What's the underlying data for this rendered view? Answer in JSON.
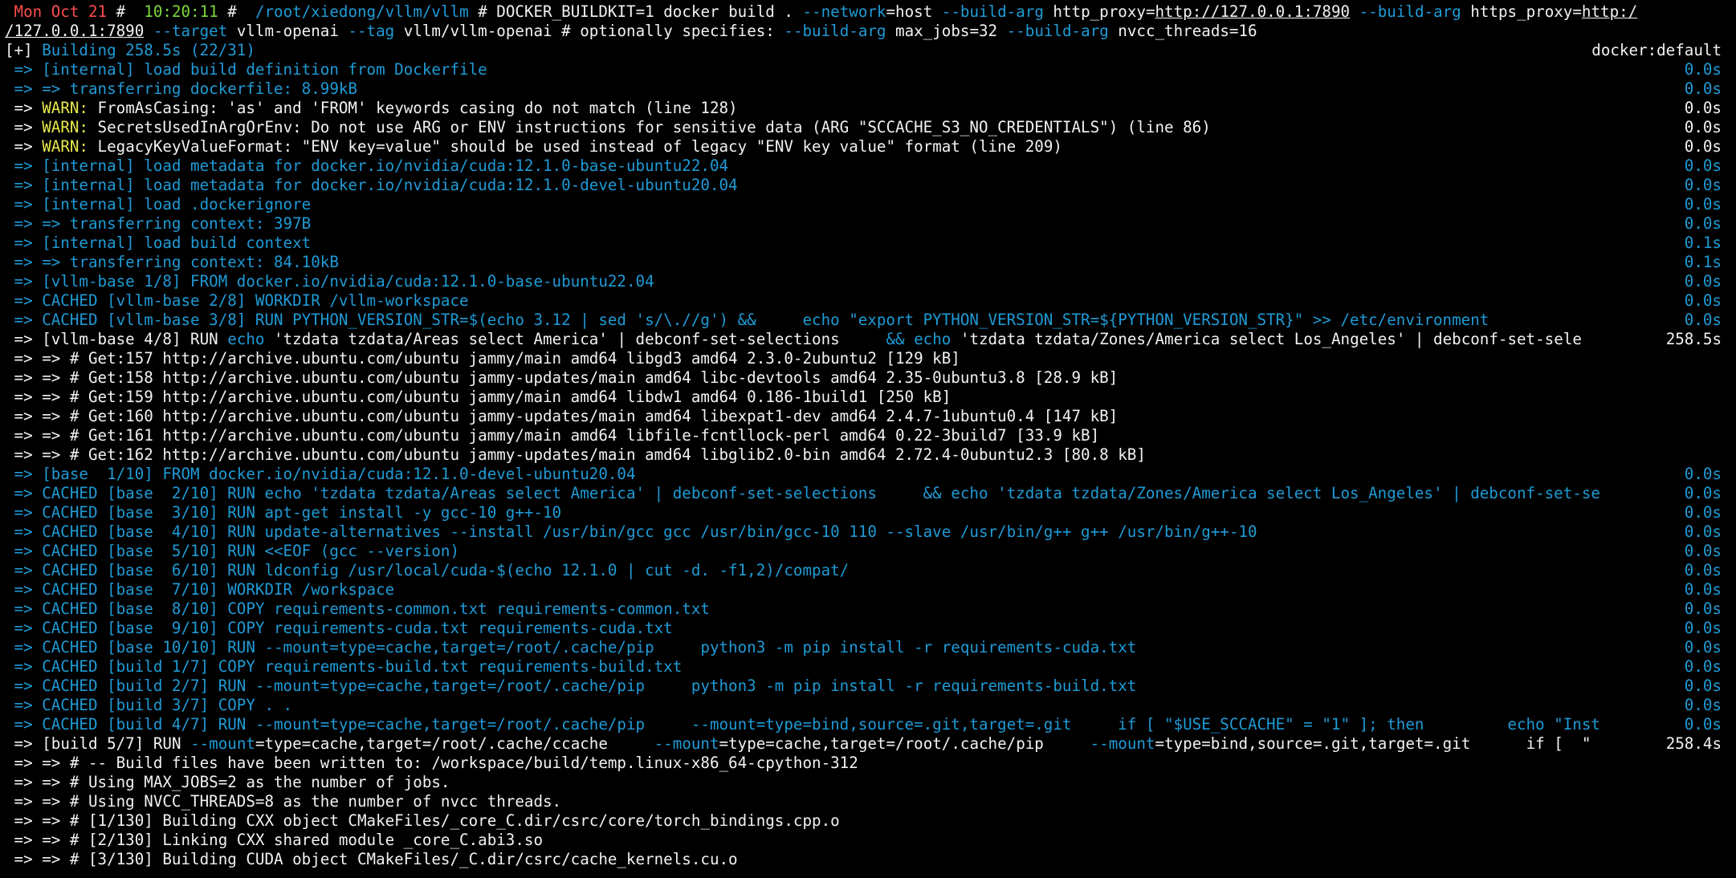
{
  "colors": {
    "background": "#000000",
    "blue": "#1f9bd6",
    "yellow": "#e8e84a",
    "red": "#ff4d4d",
    "green": "#7bd93b",
    "white": "#f2f2f2"
  },
  "prompt": {
    "date": " Mon Oct 21 ",
    "sep1": "#",
    "time": "  10:20:11 ",
    "sep2": "#",
    "cwd": "  /root/xiedong/vllm/vllm ",
    "hash": "# ",
    "cmd_part1": "DOCKER_BUILDKIT=1 docker build . ",
    "flag_network": "--network",
    "cmd_part2": "=host ",
    "flag_buildarg1": "--build-arg",
    "cmd_part3": " http_proxy=",
    "proxy_url1": "http://127.0.0.1:7890",
    "cmd_part4": " ",
    "flag_buildarg2": "--build-arg",
    "cmd_part5": " https_proxy=",
    "proxy_url2a": "http:/",
    "proxy_url2b": "/127.0.0.1:7890",
    "cmd_part6": " ",
    "flag_target": "--target",
    "cmd_part7": " vllm-openai ",
    "flag_tag": "--tag",
    "cmd_part8": " vllm/vllm-openai ",
    "cmd_part9": "# optionally specifies: ",
    "flag_buildarg3": "--build-arg",
    "cmd_part10": " max_jobs=32 ",
    "flag_buildarg4": "--build-arg",
    "cmd_part11": " nvcc_threads=16"
  },
  "build_status": {
    "bracket": "[+] ",
    "building": "Building 258.5s (22/31)",
    "driver": "docker:default"
  },
  "log_lines": [
    {
      "text": " => [internal] load build definition from Dockerfile",
      "time": "0.0s",
      "color": "blue"
    },
    {
      "text": " => => transferring dockerfile: 8.99kB",
      "time": "0.0s",
      "color": "blue"
    },
    {
      "arrow": " => ",
      "warn": "WARN:",
      "rest": " FromAsCasing: 'as' and 'FROM' keywords casing do not match (line 128)",
      "time": "0.0s"
    },
    {
      "arrow": " => ",
      "warn": "WARN:",
      "rest": " SecretsUsedInArgOrEnv: Do not use ARG or ENV instructions for sensitive data (ARG \"SCCACHE_S3_NO_CREDENTIALS\") (line 86)",
      "time": "0.0s"
    },
    {
      "arrow": " => ",
      "warn": "WARN:",
      "rest": " LegacyKeyValueFormat: \"ENV key=value\" should be used instead of legacy \"ENV key value\" format (line 209)",
      "time": "0.0s"
    },
    {
      "text": " => [internal] load metadata for docker.io/nvidia/cuda:12.1.0-base-ubuntu22.04",
      "time": "0.0s",
      "color": "blue"
    },
    {
      "text": " => [internal] load metadata for docker.io/nvidia/cuda:12.1.0-devel-ubuntu20.04",
      "time": "0.0s",
      "color": "blue"
    },
    {
      "text": " => [internal] load .dockerignore",
      "time": "0.0s",
      "color": "blue"
    },
    {
      "text": " => => transferring context: 397B",
      "time": "0.0s",
      "color": "blue"
    },
    {
      "text": " => [internal] load build context",
      "time": "0.1s",
      "color": "blue"
    },
    {
      "text": " => => transferring context: 84.10kB",
      "time": "0.1s",
      "color": "blue"
    },
    {
      "text": " => [vllm-base 1/8] FROM docker.io/nvidia/cuda:12.1.0-base-ubuntu22.04",
      "time": "0.0s",
      "color": "blue"
    },
    {
      "text": " => CACHED [vllm-base 2/8] WORKDIR /vllm-workspace",
      "time": "0.0s",
      "color": "blue"
    },
    {
      "text": " => CACHED [vllm-base 3/8] RUN PYTHON_VERSION_STR=$(echo 3.12 | sed 's/\\.//g') &&     echo \"export PYTHON_VERSION_STR=${PYTHON_VERSION_STR}\" >> /etc/environment",
      "time": "0.0s",
      "color": "blue"
    },
    {
      "arrow": " => ",
      "p1": "[vllm-base 4/8] RUN ",
      "k1": "echo",
      "p2": " 'tzdata tzdata/Areas select America' | debconf-set-selections     ",
      "k2": "&& echo",
      "p3": " 'tzdata tzdata/Zones/America select Los_Angeles' | debconf-set-sele",
      "time": "258.5s"
    },
    {
      "text": " => => # Get:157 http://archive.ubuntu.com/ubuntu jammy/main amd64 libgd3 amd64 2.3.0-2ubuntu2 [129 kB]",
      "time": "",
      "color": "white"
    },
    {
      "text": " => => # Get:158 http://archive.ubuntu.com/ubuntu jammy-updates/main amd64 libc-devtools amd64 2.35-0ubuntu3.8 [28.9 kB]",
      "time": "",
      "color": "white"
    },
    {
      "text": " => => # Get:159 http://archive.ubuntu.com/ubuntu jammy/main amd64 libdw1 amd64 0.186-1build1 [250 kB]",
      "time": "",
      "color": "white"
    },
    {
      "text": " => => # Get:160 http://archive.ubuntu.com/ubuntu jammy-updates/main amd64 libexpat1-dev amd64 2.4.7-1ubuntu0.4 [147 kB]",
      "time": "",
      "color": "white"
    },
    {
      "text": " => => # Get:161 http://archive.ubuntu.com/ubuntu jammy/main amd64 libfile-fcntllock-perl amd64 0.22-3build7 [33.9 kB]",
      "time": "",
      "color": "white"
    },
    {
      "text": " => => # Get:162 http://archive.ubuntu.com/ubuntu jammy-updates/main amd64 libglib2.0-bin amd64 2.72.4-0ubuntu2.3 [80.8 kB]",
      "time": "",
      "color": "white"
    },
    {
      "text": " => [base  1/10] FROM docker.io/nvidia/cuda:12.1.0-devel-ubuntu20.04",
      "time": "0.0s",
      "color": "blue"
    },
    {
      "text": " => CACHED [base  2/10] RUN echo 'tzdata tzdata/Areas select America' | debconf-set-selections     && echo 'tzdata tzdata/Zones/America select Los_Angeles' | debconf-set-se",
      "time": "0.0s",
      "color": "blue"
    },
    {
      "text": " => CACHED [base  3/10] RUN apt-get install -y gcc-10 g++-10",
      "time": "0.0s",
      "color": "blue"
    },
    {
      "text": " => CACHED [base  4/10] RUN update-alternatives --install /usr/bin/gcc gcc /usr/bin/gcc-10 110 --slave /usr/bin/g++ g++ /usr/bin/g++-10",
      "time": "0.0s",
      "color": "blue"
    },
    {
      "text": " => CACHED [base  5/10] RUN <<EOF (gcc --version)",
      "time": "0.0s",
      "color": "blue"
    },
    {
      "text": " => CACHED [base  6/10] RUN ldconfig /usr/local/cuda-$(echo 12.1.0 | cut -d. -f1,2)/compat/",
      "time": "0.0s",
      "color": "blue"
    },
    {
      "text": " => CACHED [base  7/10] WORKDIR /workspace",
      "time": "0.0s",
      "color": "blue"
    },
    {
      "text": " => CACHED [base  8/10] COPY requirements-common.txt requirements-common.txt",
      "time": "0.0s",
      "color": "blue"
    },
    {
      "text": " => CACHED [base  9/10] COPY requirements-cuda.txt requirements-cuda.txt",
      "time": "0.0s",
      "color": "blue"
    },
    {
      "text": " => CACHED [base 10/10] RUN --mount=type=cache,target=/root/.cache/pip     python3 -m pip install -r requirements-cuda.txt",
      "time": "0.0s",
      "color": "blue"
    },
    {
      "text": " => CACHED [build 1/7] COPY requirements-build.txt requirements-build.txt",
      "time": "0.0s",
      "color": "blue"
    },
    {
      "text": " => CACHED [build 2/7] RUN --mount=type=cache,target=/root/.cache/pip     python3 -m pip install -r requirements-build.txt",
      "time": "0.0s",
      "color": "blue"
    },
    {
      "text": " => CACHED [build 3/7] COPY . .",
      "time": "0.0s",
      "color": "blue"
    },
    {
      "text": " => CACHED [build 4/7] RUN --mount=type=cache,target=/root/.cache/pip     --mount=type=bind,source=.git,target=.git     if [ \"$USE_SCCACHE\" = \"1\" ]; then         echo \"Inst",
      "time": "0.0s",
      "color": "blue"
    },
    {
      "arrow": " => ",
      "p1": "[build 5/7] RUN ",
      "k1": "--mount",
      "p2": "=type=cache,target=/root/.cache/ccache     ",
      "k2": "--mount",
      "p3": "=type=cache,target=/root/.cache/pip     ",
      "k3": "--mount",
      "p4": "=type=bind,source=.git,target=.git      if [  \" ",
      "time": "258.4s"
    },
    {
      "text": " => => # -- Build files have been written to: /workspace/build/temp.linux-x86_64-cpython-312",
      "time": "",
      "color": "white"
    },
    {
      "text": " => => # Using MAX_JOBS=2 as the number of jobs.",
      "time": "",
      "color": "white"
    },
    {
      "text": " => => # Using NVCC_THREADS=8 as the number of nvcc threads.",
      "time": "",
      "color": "white"
    },
    {
      "text": " => => # [1/130] Building CXX object CMakeFiles/_core_C.dir/csrc/core/torch_bindings.cpp.o",
      "time": "",
      "color": "white"
    },
    {
      "text": " => => # [2/130] Linking CXX shared module _core_C.abi3.so",
      "time": "",
      "color": "white"
    },
    {
      "text": " => => # [3/130] Building CUDA object CMakeFiles/_C.dir/csrc/cache_kernels.cu.o",
      "time": "",
      "color": "white"
    }
  ]
}
